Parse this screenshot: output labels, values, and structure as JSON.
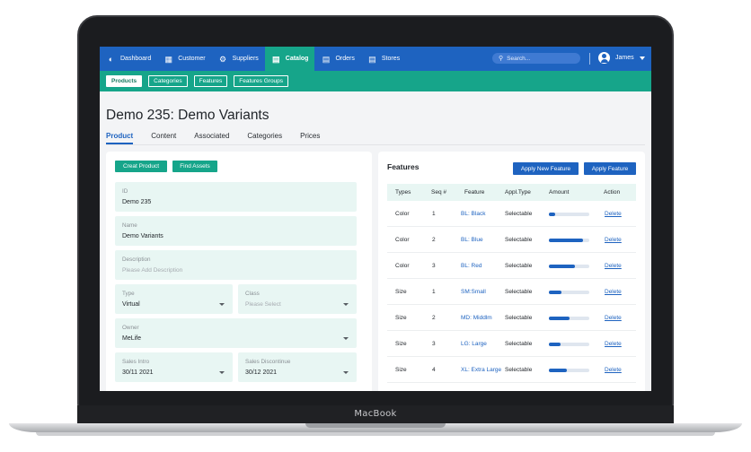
{
  "device": {
    "label": "MacBook"
  },
  "topnav": {
    "items": [
      {
        "label": "Dashboard",
        "icon": "dashboard-icon",
        "active": false
      },
      {
        "label": "Customer",
        "icon": "customer-icon",
        "active": false
      },
      {
        "label": "Suppliers",
        "icon": "suppliers-icon",
        "active": false
      },
      {
        "label": "Catalog",
        "icon": "catalog-icon",
        "active": true
      },
      {
        "label": "Orders",
        "icon": "orders-icon",
        "active": false
      },
      {
        "label": "Stores",
        "icon": "stores-icon",
        "active": false
      }
    ],
    "search_placeholder": "Search...",
    "user_name": "James"
  },
  "subnav": {
    "items": [
      {
        "label": "Products",
        "active": true
      },
      {
        "label": "Categories",
        "active": false
      },
      {
        "label": "Features",
        "active": false
      },
      {
        "label": "Features Groups",
        "active": false
      }
    ]
  },
  "page": {
    "title": "Demo 235: Demo Variants",
    "tabs": [
      "Product",
      "Content",
      "Associated",
      "Categories",
      "Prices"
    ]
  },
  "form": {
    "create_button": "Creat Product",
    "find_button": "Find Assets",
    "id": {
      "label": "ID",
      "value": "Demo 235"
    },
    "name": {
      "label": "Name",
      "value": "Demo Variants"
    },
    "description": {
      "label": "Description",
      "placeholder": "Please Add Description"
    },
    "type": {
      "label": "Type",
      "value": "Virtual"
    },
    "class": {
      "label": "Class",
      "placeholder": "Please Select"
    },
    "owner": {
      "label": "Owner",
      "value": "MeLife"
    },
    "sales_intro": {
      "label": "Sales Intro",
      "value": "30/11 2021"
    },
    "sales_discontinue": {
      "label": "Sales Discontinue",
      "value": "30/12 2021"
    }
  },
  "features": {
    "title": "Features",
    "apply_new_button": "Apply New Feature",
    "apply_button": "Apply Feature",
    "columns": [
      "Types",
      "Seq #",
      "Feature",
      "Appl.Type",
      "Amount",
      "Action"
    ],
    "rows": [
      {
        "type": "Color",
        "seq": "1",
        "feature": "BL: Black",
        "appl_type": "Selectable",
        "amount": 0.15,
        "action": "Delete"
      },
      {
        "type": "Color",
        "seq": "2",
        "feature": "BL: Blue",
        "appl_type": "Selectable",
        "amount": 0.85,
        "action": "Delete"
      },
      {
        "type": "Color",
        "seq": "3",
        "feature": "BL: Red",
        "appl_type": "Selectable",
        "amount": 0.65,
        "action": "Delete"
      },
      {
        "type": "Size",
        "seq": "1",
        "feature": "SM:Small",
        "appl_type": "Selectable",
        "amount": 0.3,
        "action": "Delete"
      },
      {
        "type": "Size",
        "seq": "2",
        "feature": "MD: Middlm",
        "appl_type": "Selectable",
        "amount": 0.5,
        "action": "Delete"
      },
      {
        "type": "Size",
        "seq": "3",
        "feature": "LG: Large",
        "appl_type": "Selectable",
        "amount": 0.28,
        "action": "Delete"
      },
      {
        "type": "Size",
        "seq": "4",
        "feature": "XL: Extra Large",
        "appl_type": "Selectable",
        "amount": 0.45,
        "action": "Delete"
      }
    ]
  },
  "colors": {
    "primary": "#1e63c0",
    "accent": "#16a58a",
    "field_bg": "#e8f6f3"
  }
}
